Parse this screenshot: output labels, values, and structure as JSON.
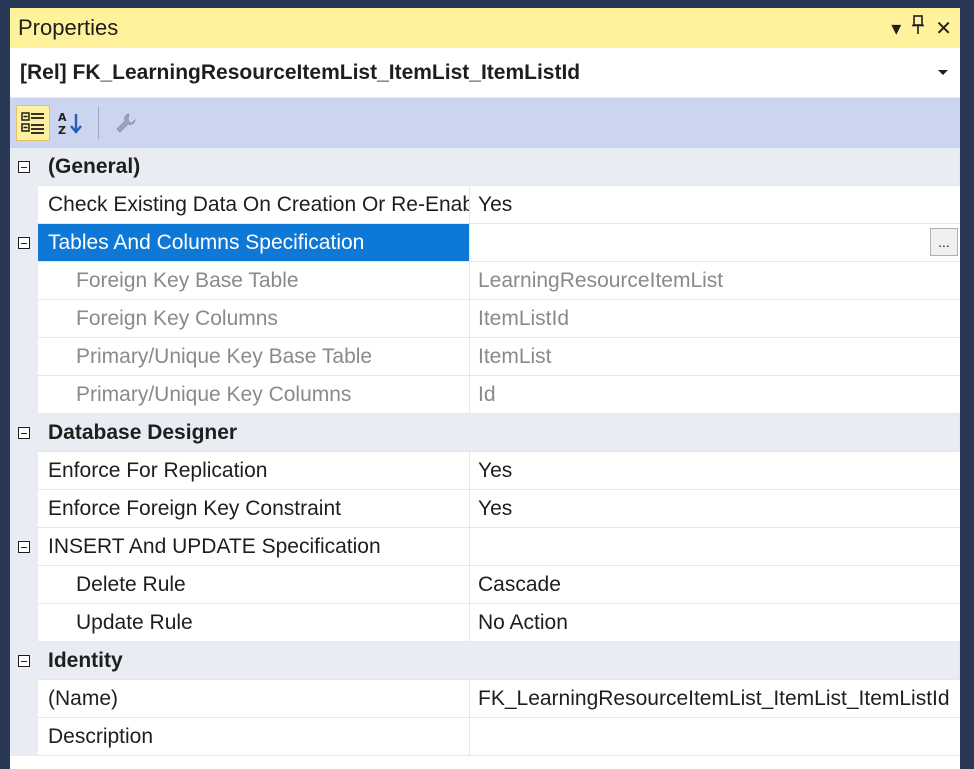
{
  "titlebar": {
    "title": "Properties",
    "dropdown_glyph": "▾",
    "pin_glyph": "⊣",
    "close_glyph": "✕"
  },
  "object_selector": {
    "value": "[Rel] FK_LearningResourceItemList_ItemList_ItemListId"
  },
  "toolbar": {
    "categorized_icon": "categorized-icon",
    "alphabetical_icon": "alphabetical-icon",
    "property_pages_icon": "wrench-icon"
  },
  "colors": {
    "title_bar": "#fff29d",
    "toolbar": "#ccd5f0",
    "selection": "#0e78d6",
    "frame": "#293955"
  },
  "properties": {
    "general": {
      "category": "(General)",
      "check_existing": {
        "name": "Check Existing Data On Creation Or Re-Enabling",
        "value": "Yes"
      },
      "tables_and_columns": {
        "name": "Tables And Columns Specification",
        "value": "",
        "button": "..."
      },
      "fk_base_table": {
        "name": "Foreign Key Base Table",
        "value": "LearningResourceItemList"
      },
      "fk_columns": {
        "name": "Foreign Key Columns",
        "value": "ItemListId"
      },
      "pk_base_table": {
        "name": "Primary/Unique Key Base Table",
        "value": "ItemList"
      },
      "pk_columns": {
        "name": "Primary/Unique Key Columns",
        "value": "Id"
      }
    },
    "database_designer": {
      "category": "Database Designer",
      "enforce_replication": {
        "name": "Enforce For Replication",
        "value": "Yes"
      },
      "enforce_fk": {
        "name": "Enforce Foreign Key Constraint",
        "value": "Yes"
      },
      "insert_update": {
        "name": "INSERT And UPDATE Specification",
        "value": ""
      },
      "delete_rule": {
        "name": "Delete Rule",
        "value": "Cascade"
      },
      "update_rule": {
        "name": "Update Rule",
        "value": "No Action"
      }
    },
    "identity": {
      "category": "Identity",
      "name": {
        "name": "(Name)",
        "value": "FK_LearningResourceItemList_ItemList_ItemListId"
      },
      "description": {
        "name": "Description",
        "value": ""
      }
    }
  }
}
